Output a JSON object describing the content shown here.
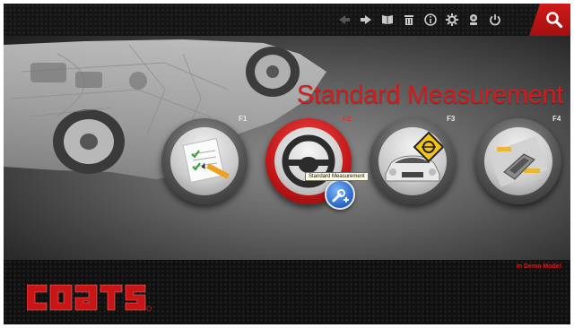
{
  "toolbar": {
    "icons": [
      "back-arrow-icon",
      "forward-arrow-icon",
      "book-icon",
      "trash-icon",
      "info-icon",
      "settings-gear-icon",
      "help-person-icon",
      "power-icon",
      "search-icon"
    ]
  },
  "headline": "Standard Measurement",
  "functions": [
    {
      "key": "F1",
      "icon": "notepad-pencil-icon"
    },
    {
      "key": "F2",
      "icon": "steering-wheel-icon",
      "active": true
    },
    {
      "key": "F3",
      "icon": "car-alignment-sign-icon"
    },
    {
      "key": "F4",
      "icon": "vehicle-lift-icon"
    }
  ],
  "tooltip": "Standard Measurement",
  "status": "In Demo Mode!",
  "brand": "COATS",
  "colors": {
    "accent": "#d31d1d",
    "toolbar": "#151515"
  }
}
